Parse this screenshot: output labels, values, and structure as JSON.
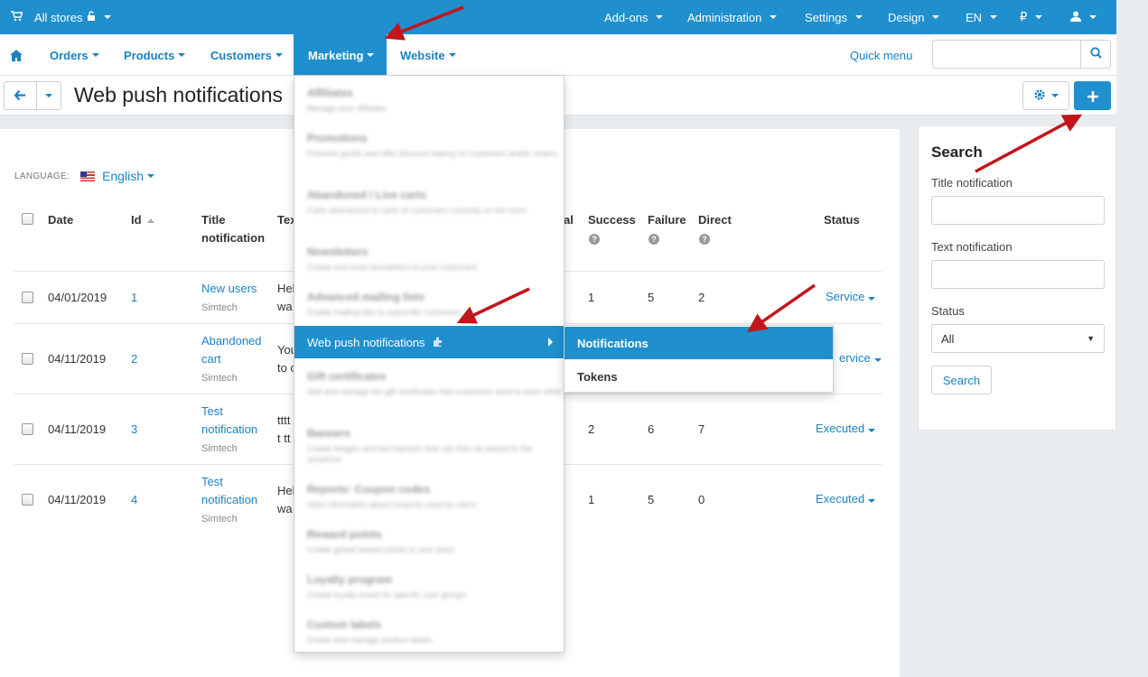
{
  "topbar": {
    "store": "All stores",
    "items": [
      "Add-ons",
      "Administration",
      "Settings",
      "Design",
      "EN",
      "₽"
    ]
  },
  "nav": {
    "items": [
      "Orders",
      "Products",
      "Customers",
      "Marketing",
      "Website"
    ],
    "quick_menu": "Quick menu"
  },
  "page": {
    "title": "Web push notifications"
  },
  "language": {
    "label": "LANGUAGE:",
    "value": "English"
  },
  "table": {
    "headers": {
      "date": "Date",
      "id": "Id",
      "title_line1": "Title",
      "title_line2": "notification",
      "text": "Tex",
      "total": "al",
      "success": "Success",
      "failure": "Failure",
      "direct": "Direct",
      "status": "Status"
    },
    "rows": [
      {
        "date": "04/01/2019",
        "id": "1",
        "title1": "New users",
        "title2": "",
        "company": "Simtech",
        "text1": "Hel",
        "text2": "wa",
        "success": "1",
        "failure": "5",
        "direct": "2",
        "status": "Service"
      },
      {
        "date": "04/11/2019",
        "id": "2",
        "title1": "Abandoned",
        "title2": "cart",
        "company": "Simtech",
        "text1": "You",
        "text2": "to c",
        "success": "",
        "failure": "",
        "direct": "",
        "status": "ervice"
      },
      {
        "date": "04/11/2019",
        "id": "3",
        "title1": "Test",
        "title2": "notification",
        "company": "Simtech",
        "text1": "tttt",
        "text2": "t tt",
        "success": "2",
        "failure": "6",
        "direct": "7",
        "status": "Executed"
      },
      {
        "date": "04/11/2019",
        "id": "4",
        "title1": "Test",
        "title2": "notification",
        "company": "Simtech",
        "text1": "Hel",
        "text2": "wa",
        "success": "1",
        "failure": "5",
        "direct": "0",
        "status": "Executed"
      }
    ]
  },
  "sidebar": {
    "title": "Search",
    "title_label": "Title notification",
    "text_label": "Text notification",
    "status_label": "Status",
    "status_value": "All",
    "search_button": "Search"
  },
  "menu": {
    "items": [
      {
        "title": "Affiliates",
        "desc": "Manage your affiliates"
      },
      {
        "title": "Promotions",
        "desc": "Promote goods and offer discount basing on customers and/or orders"
      },
      {
        "title": "Abandoned / Live carts",
        "desc": "Carts abandoned or carts of customers currently on the store"
      },
      {
        "title": "Newsletters",
        "desc": "Create and send newsletters to your customers"
      },
      {
        "title": "Advanced mailing lists",
        "desc": "Create mailing lists to subscribe customers"
      },
      {
        "title": "Web push notifications",
        "desc": ""
      },
      {
        "title": "Gift certificates",
        "desc": "Add and manage the gift certificates that customers send to each other"
      },
      {
        "title": "Banners",
        "desc": "Create images and text banners that can then be placed to the storefront"
      },
      {
        "title": "Reports: Coupon codes",
        "desc": "View information about coupons used by users"
      },
      {
        "title": "Reward points",
        "desc": "Create global reward points to your store"
      },
      {
        "title": "Loyalty program",
        "desc": "Create loyalty levels for specific user groups"
      },
      {
        "title": "Custom labels",
        "desc": "Create and manage product labels"
      }
    ],
    "submenu": [
      "Notifications",
      "Tokens"
    ]
  },
  "colors": {
    "brand": "#1f8fcd",
    "link": "#1a82c3",
    "annotation": "#c0161c"
  }
}
